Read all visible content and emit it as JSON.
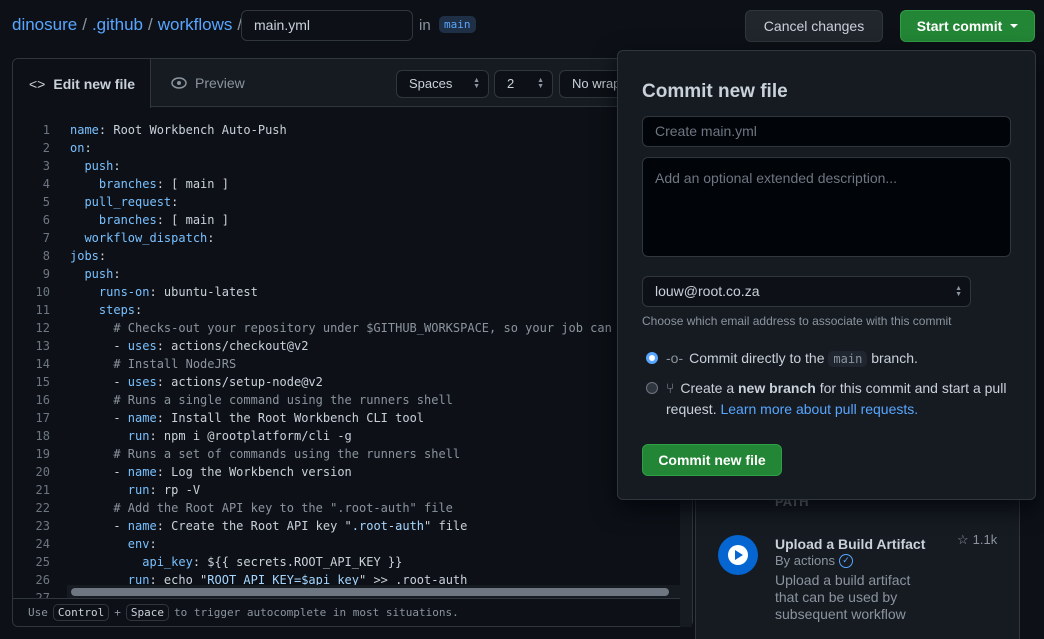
{
  "breadcrumb": {
    "owner": "dinosure",
    "dir1": ".github",
    "dir2": "workflows",
    "sep": "/"
  },
  "filename": "main.yml",
  "in_label": "in",
  "branch": "main",
  "header": {
    "cancel": "Cancel changes",
    "start": "Start commit"
  },
  "editor": {
    "tab_edit": "Edit new file",
    "tab_preview": "Preview",
    "indent_mode": "Spaces",
    "indent_size": "2",
    "wrap_mode": "No wrap",
    "lines": [
      "name: Root Workbench Auto-Push",
      "on:",
      "  push:",
      "    branches: [ main ]",
      "  pull_request:",
      "    branches: [ main ]",
      "  workflow_dispatch:",
      "jobs:",
      "  push:",
      "    runs-on: ubuntu-latest",
      "    steps:",
      "      # Checks-out your repository under $GITHUB_WORKSPACE, so your job can",
      "      - uses: actions/checkout@v2",
      "      # Install NodeJRS",
      "      - uses: actions/setup-node@v2",
      "      # Runs a single command using the runners shell",
      "      - name: Install the Root Workbench CLI tool",
      "        run: npm i @rootplatform/cli -g",
      "      # Runs a set of commands using the runners shell",
      "      - name: Log the Workbench version",
      "        run: rp -V",
      "      # Add the Root API key to the \".root-auth\" file",
      "      - name: Create the Root API key \".root-auth\" file",
      "        env:",
      "          api_key: ${{ secrets.ROOT_API_KEY }}",
      "        run: echo \"ROOT_API_KEY=$api_key\" >> .root-auth",
      ""
    ],
    "footer": {
      "use": "Use",
      "key1": "Control",
      "plus": "+",
      "key2": "Space",
      "rest": "to trigger autocomplete in most situations."
    }
  },
  "sidebar": {
    "section": "PATH",
    "action": {
      "title": "Upload a Build Artifact",
      "by": "By actions",
      "stars": "1.1k",
      "desc": "Upload a build artifact that can be used by subsequent workflow"
    }
  },
  "popup": {
    "title": "Commit new file",
    "summary_placeholder": "Create main.yml",
    "desc_placeholder": "Add an optional extended description...",
    "email": "louw@root.co.za",
    "email_help": "Choose which email address to associate with this commit",
    "opt1_pre": "Commit directly to the",
    "opt1_branch": "main",
    "opt1_post": "branch.",
    "opt2_pre": "Create a",
    "opt2_bold": "new branch",
    "opt2_post": "for this commit and start a pull request.",
    "opt2_link": "Learn more about pull requests.",
    "opt1_selected": true,
    "submit": "Commit new file"
  },
  "colors": {
    "accent": "#58a6ff",
    "green": "#238636"
  }
}
